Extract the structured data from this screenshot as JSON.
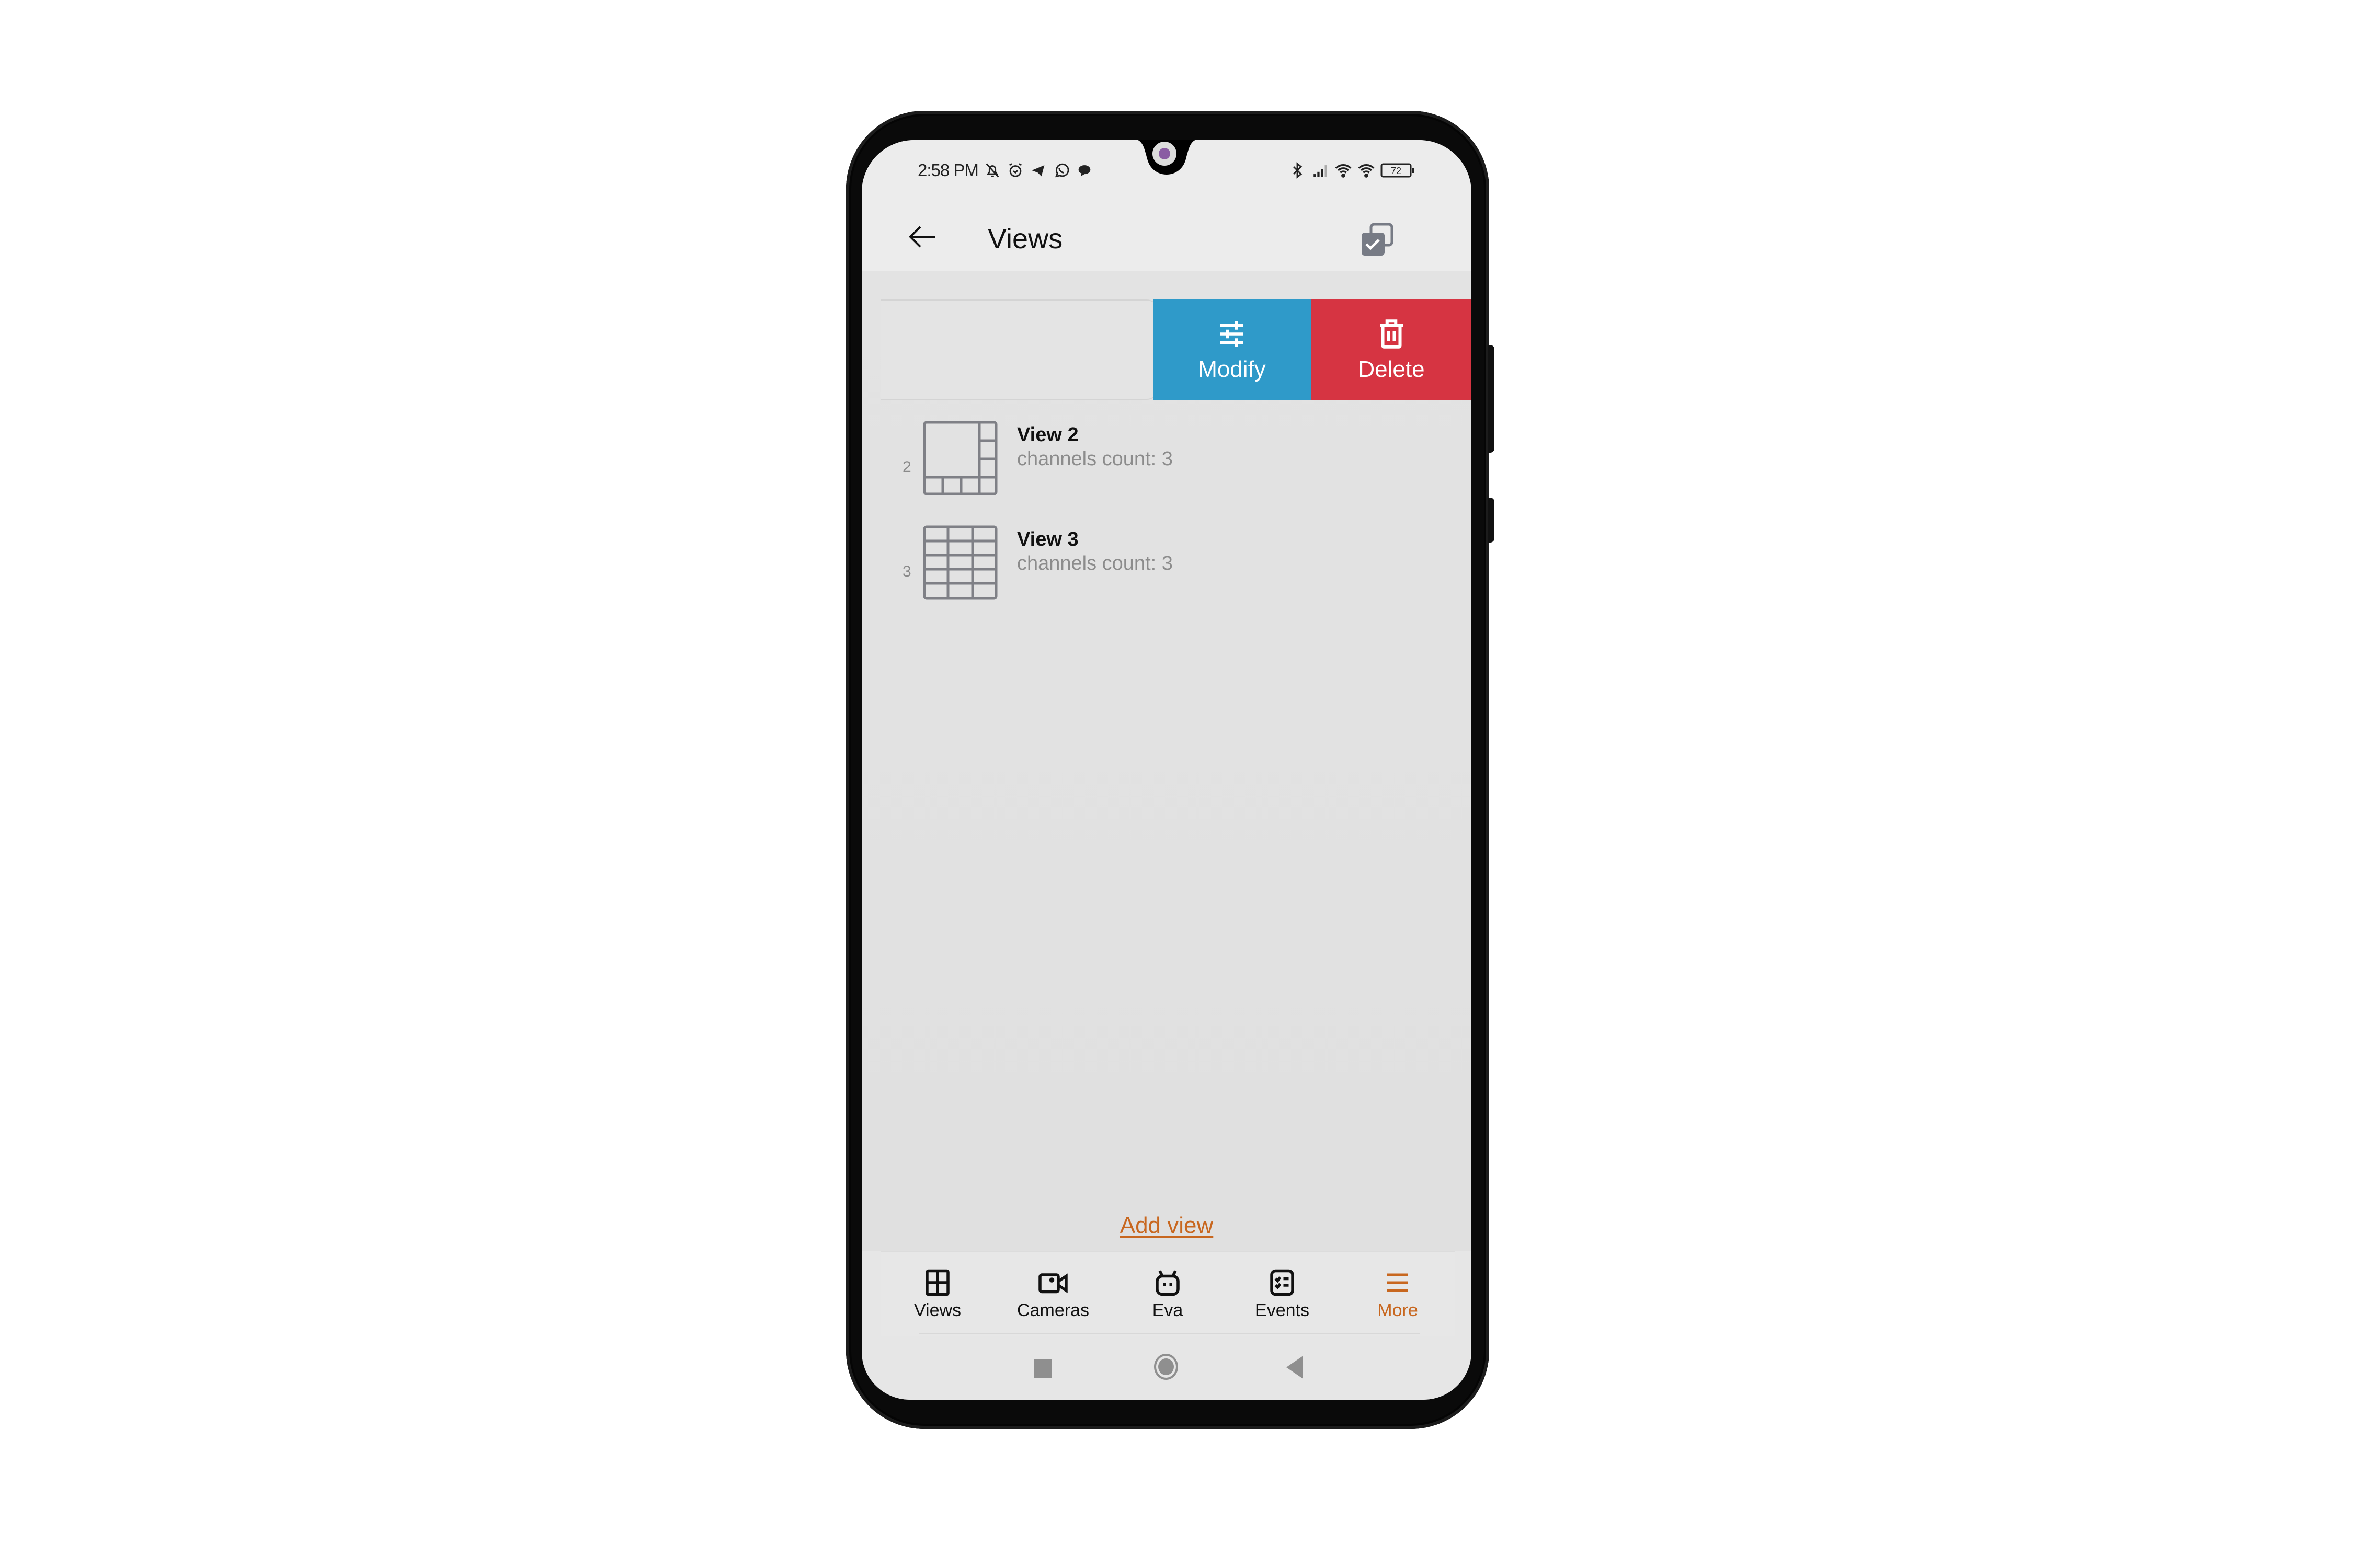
{
  "status_bar": {
    "time": "2:58 PM",
    "left_icons": [
      "bell-off-icon",
      "alarm-icon",
      "telegram-icon",
      "whatsapp-icon",
      "message-icon"
    ],
    "right_icons": [
      "bluetooth-icon",
      "signal-icon",
      "wifi-link-icon",
      "wifi-icon",
      "battery-icon"
    ],
    "battery": "72"
  },
  "header": {
    "title": "Views",
    "back_icon": "arrow-left-icon",
    "action_icon": "select-all-icon"
  },
  "swipe_actions": {
    "modify_label": "Modify",
    "delete_label": "Delete",
    "modify_color": "#2F9AC9",
    "delete_color": "#D63442"
  },
  "views": [
    {
      "index": "2",
      "title": "View 2",
      "subtitle": "channels count: 3",
      "layout_icon": "layout-1-big-7-small-icon"
    },
    {
      "index": "3",
      "title": "View 3",
      "subtitle": "channels count: 3",
      "layout_icon": "layout-3x5-grid-icon"
    }
  ],
  "add_view_label": "Add view",
  "accent_color": "#C8671F",
  "bottom_nav": {
    "items": [
      {
        "label": "Views",
        "icon": "grid-icon",
        "active": false
      },
      {
        "label": "Cameras",
        "icon": "video-camera-icon",
        "active": false
      },
      {
        "label": "Eva",
        "icon": "robot-icon",
        "active": false
      },
      {
        "label": "Events",
        "icon": "checklist-icon",
        "active": false
      },
      {
        "label": "More",
        "icon": "menu-icon",
        "active": true
      }
    ]
  },
  "system_nav": [
    "recents-button",
    "home-button",
    "back-button"
  ]
}
